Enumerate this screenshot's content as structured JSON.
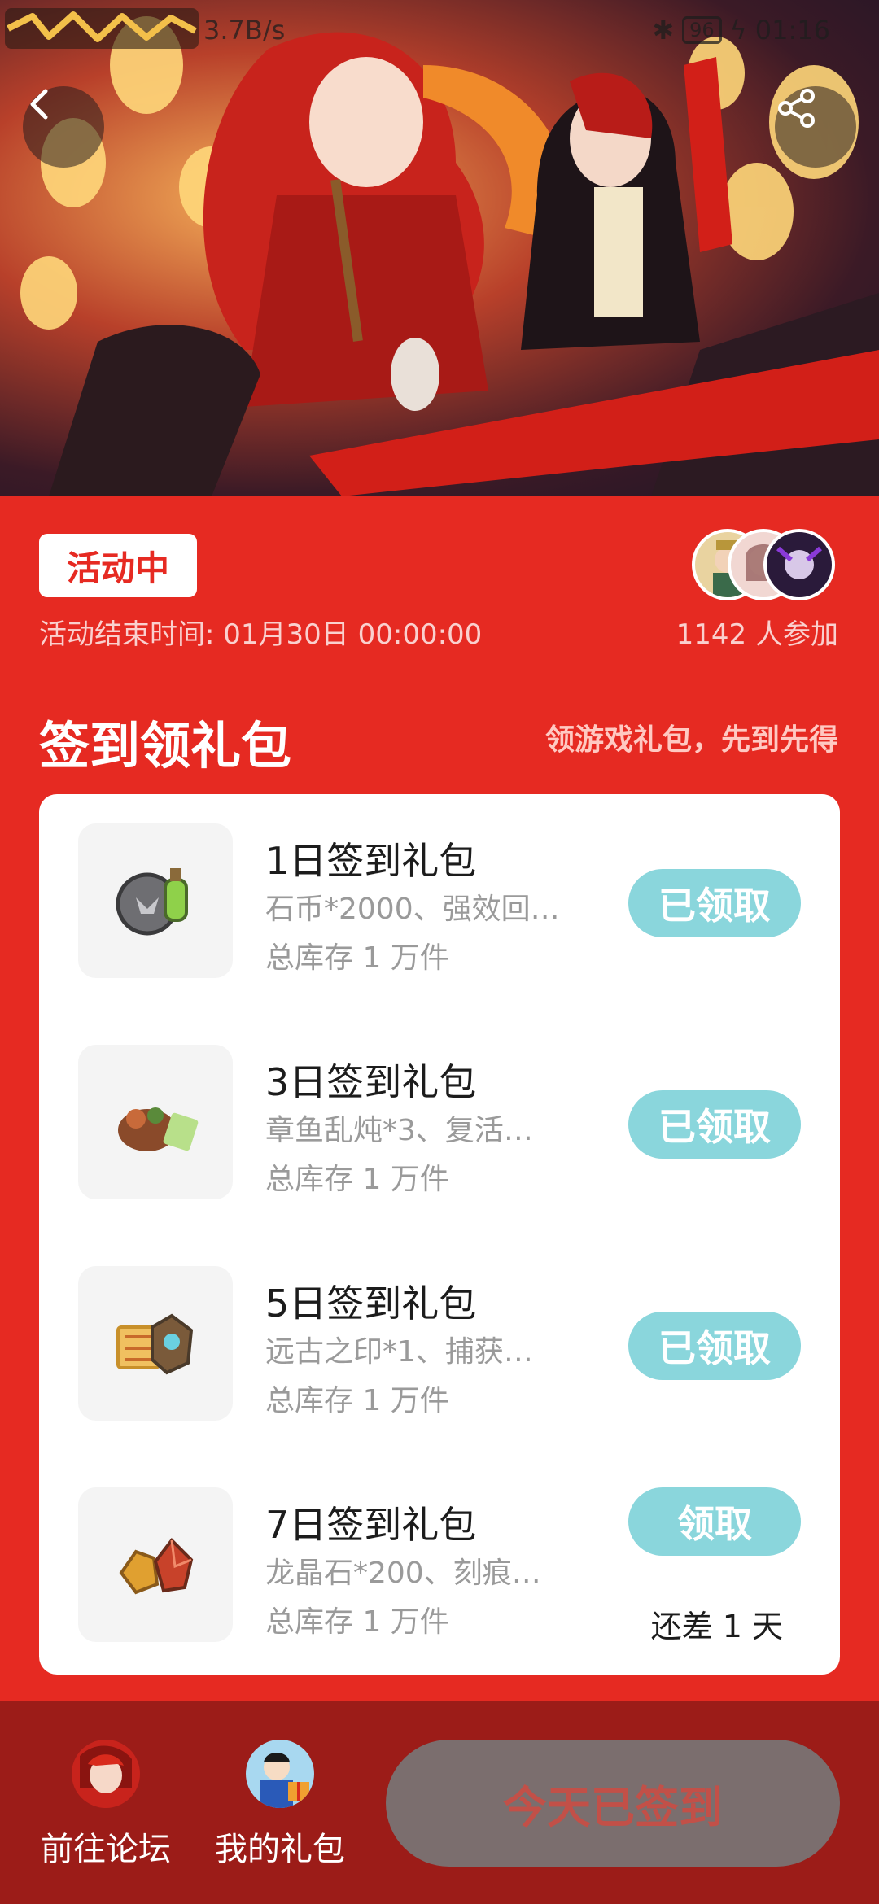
{
  "status_bar": {
    "speed": "3.7B/s",
    "battery": "96",
    "time": "01:16"
  },
  "activity": {
    "status_tag": "活动中",
    "end_time": "活动结束时间: 01月30日 00:00:00",
    "participants": "1142 人参加"
  },
  "section": {
    "title": "签到领礼包",
    "subtitle": "领游戏礼包，先到先得"
  },
  "gifts": [
    {
      "title": "1日签到礼包",
      "desc": "石币*2000、强效回…",
      "stock": "总库存 1 万件",
      "button": "已领取",
      "note": ""
    },
    {
      "title": "3日签到礼包",
      "desc": "章鱼乱炖*3、复活…",
      "stock": "总库存 1 万件",
      "button": "已领取",
      "note": ""
    },
    {
      "title": "5日签到礼包",
      "desc": "远古之印*1、捕获…",
      "stock": "总库存 1 万件",
      "button": "已领取",
      "note": ""
    },
    {
      "title": "7日签到礼包",
      "desc": "龙晶石*200、刻痕…",
      "stock": "总库存 1 万件",
      "button": "领取",
      "note": "还差 1 天"
    }
  ],
  "bottom": {
    "forum_label": "前往论坛",
    "my_gifts_label": "我的礼包",
    "sign_button": "今天已签到"
  },
  "icons": {
    "back": "back-arrow-icon",
    "share": "share-icon"
  },
  "colors": {
    "page_bg": "#e62a22",
    "bottom_bar": "#9c1c18",
    "claimed_button": "#8ad6dc",
    "signed_button": "#7b6e6e"
  }
}
